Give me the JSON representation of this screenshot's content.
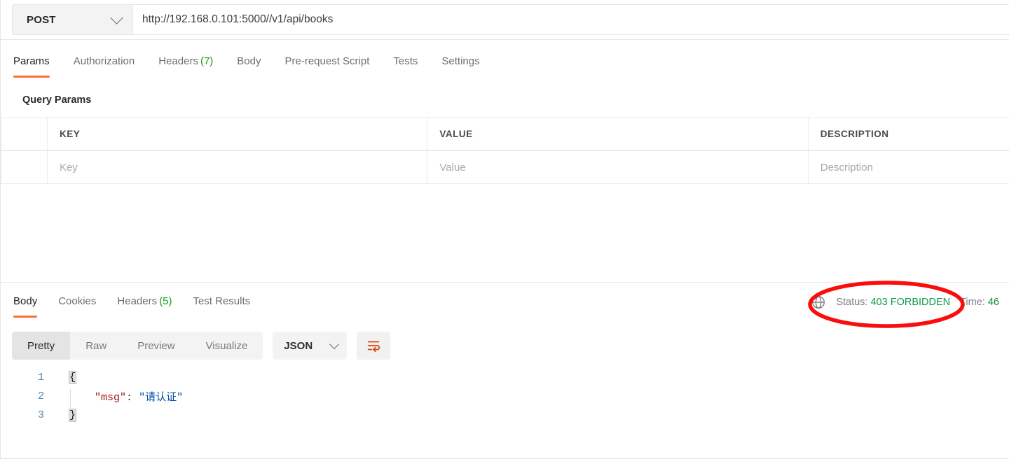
{
  "request": {
    "method": "POST",
    "method_chevron_icon": "chevron-down-icon",
    "url": "http://192.168.0.101:5000//v1/api/books",
    "tabs": [
      {
        "label": "Params",
        "count": null,
        "active": true
      },
      {
        "label": "Authorization",
        "count": null,
        "active": false
      },
      {
        "label": "Headers",
        "count": "(7)",
        "active": false
      },
      {
        "label": "Body",
        "count": null,
        "active": false
      },
      {
        "label": "Pre-request Script",
        "count": null,
        "active": false
      },
      {
        "label": "Tests",
        "count": null,
        "active": false
      },
      {
        "label": "Settings",
        "count": null,
        "active": false
      }
    ],
    "query_params": {
      "section_title": "Query Params",
      "columns": [
        "KEY",
        "VALUE",
        "DESCRIPTION"
      ],
      "placeholder_row": {
        "key": "Key",
        "value": "Value",
        "description": "Description"
      }
    }
  },
  "response": {
    "tabs": [
      {
        "label": "Body",
        "count": null,
        "active": true
      },
      {
        "label": "Cookies",
        "count": null,
        "active": false
      },
      {
        "label": "Headers",
        "count": "(5)",
        "active": false
      },
      {
        "label": "Test Results",
        "count": null,
        "active": false
      }
    ],
    "meta": {
      "globe_icon": "globe-icon",
      "status_label": "Status:",
      "status_value": "403 FORBIDDEN",
      "time_label": "Time:",
      "time_value": "46"
    },
    "annotation": {
      "shape": "ellipse",
      "color": "#fb0d0d",
      "target": "status-value"
    },
    "toolbar": {
      "views": [
        {
          "label": "Pretty",
          "active": true
        },
        {
          "label": "Raw",
          "active": false
        },
        {
          "label": "Preview",
          "active": false
        },
        {
          "label": "Visualize",
          "active": false
        }
      ],
      "format": "JSON",
      "format_chevron_icon": "chevron-down-icon",
      "wrap_icon": "word-wrap-icon"
    },
    "body": {
      "language": "json",
      "lines": [
        {
          "number": "1",
          "open_brace": "{"
        },
        {
          "number": "2",
          "key": "\"msg\"",
          "colon": ":",
          "value": "\"请认证\""
        },
        {
          "number": "3",
          "close_brace": "}"
        }
      ]
    }
  },
  "colors": {
    "accent": "#ff6c37",
    "status_green": "#0f9b4a",
    "count_green": "#10a210",
    "annotation_red": "#fb0d0d",
    "json_key": "#a31515",
    "json_string": "#0451a5",
    "gutter_blue": "#5c86ad"
  }
}
